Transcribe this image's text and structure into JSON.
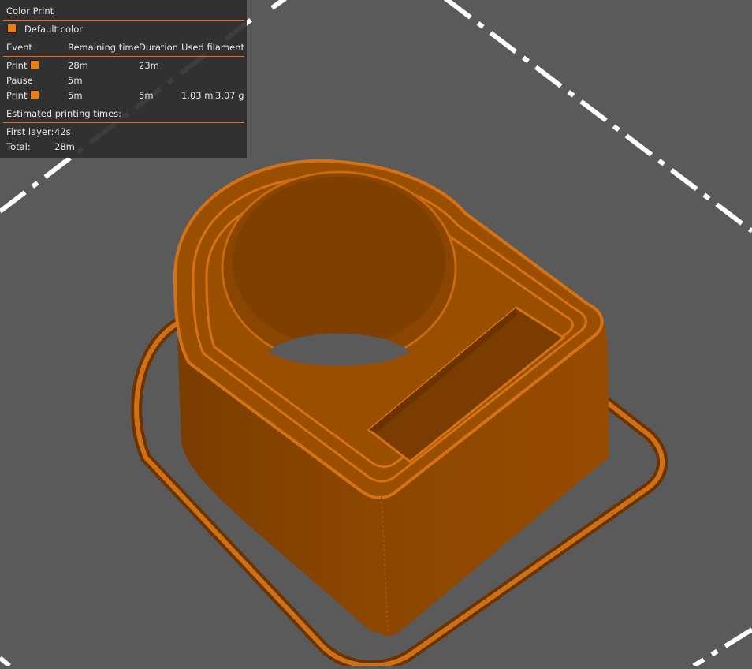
{
  "legend": {
    "title": "Color Print",
    "default_color_label": "Default color",
    "swatch_color": "#f07c0c",
    "accent_color": "#ed6b21",
    "columns": [
      "Event",
      "Remaining time",
      "Duration",
      "Used filament"
    ],
    "rows": [
      {
        "event": "Print",
        "has_swatch": true,
        "remaining": "28m",
        "duration": "23m",
        "filament_m": "",
        "filament_g": ""
      },
      {
        "event": "Pause",
        "has_swatch": false,
        "remaining": "5m",
        "duration": "",
        "filament_m": "",
        "filament_g": ""
      },
      {
        "event": "Print",
        "has_swatch": true,
        "remaining": "5m",
        "duration": "5m",
        "filament_m": "1.03 m",
        "filament_g": "3.07 g"
      }
    ],
    "estimated_title": "Estimated printing times:",
    "first_layer_label": "First layer:",
    "first_layer_value": "42s",
    "total_label": "Total:",
    "total_value": "28m"
  },
  "scene": {
    "background_color": "#5a5a5a",
    "model_color": "#8a4500",
    "model_highlight_color": "#c86a10",
    "bed_outline_color": "#ffffff"
  }
}
